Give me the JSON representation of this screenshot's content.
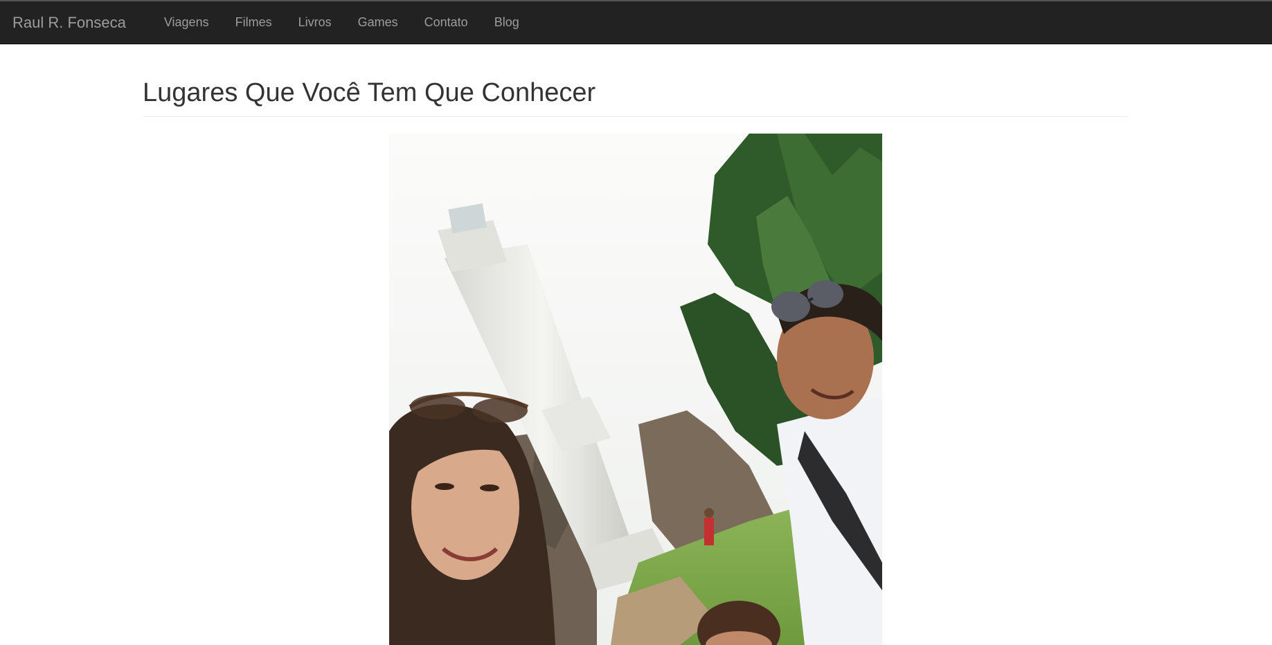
{
  "navbar": {
    "brand": "Raul R. Fonseca",
    "items": [
      {
        "label": "Viagens"
      },
      {
        "label": "Filmes"
      },
      {
        "label": "Livros"
      },
      {
        "label": "Games"
      },
      {
        "label": "Contato"
      },
      {
        "label": "Blog"
      }
    ]
  },
  "main": {
    "title": "Lugares Que Você Tem Que Conhecer"
  },
  "colors": {
    "navbar_bg": "#222222",
    "nav_text": "#9d9d9d",
    "title_text": "#333333"
  }
}
